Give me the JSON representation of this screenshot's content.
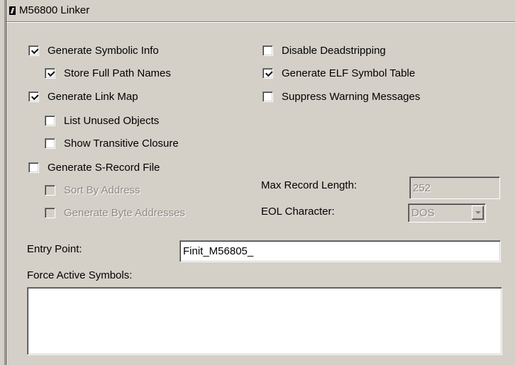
{
  "panel": {
    "title": "M56800 Linker"
  },
  "checkboxes": {
    "generate_symbolic_info": {
      "label": "Generate Symbolic Info",
      "checked": true
    },
    "store_full_path_names": {
      "label": "Store Full Path Names",
      "checked": true
    },
    "generate_link_map": {
      "label": "Generate Link Map",
      "checked": true
    },
    "list_unused_objects": {
      "label": "List Unused Objects",
      "checked": false
    },
    "show_transitive_closure": {
      "label": "Show Transitive Closure",
      "checked": false
    },
    "generate_s_record_file": {
      "label": "Generate S-Record File",
      "checked": false
    },
    "sort_by_address": {
      "label": "Sort By Address",
      "checked": false,
      "disabled": true
    },
    "generate_byte_addresses": {
      "label": "Generate Byte Addresses",
      "checked": false,
      "disabled": true
    },
    "disable_deadstripping": {
      "label": "Disable Deadstripping",
      "checked": false
    },
    "generate_elf_symbol_table": {
      "label": "Generate ELF Symbol Table",
      "checked": true
    },
    "suppress_warning_messages": {
      "label": "Suppress Warning Messages",
      "checked": false
    }
  },
  "fields": {
    "max_record_length": {
      "label": "Max Record Length:",
      "value": "252"
    },
    "eol_character": {
      "label": "EOL Character:",
      "value": "DOS"
    },
    "entry_point": {
      "label": "Entry Point:",
      "value": "Finit_M56805_"
    },
    "force_active_symbols": {
      "label": "Force Active Symbols:",
      "value": ""
    }
  }
}
